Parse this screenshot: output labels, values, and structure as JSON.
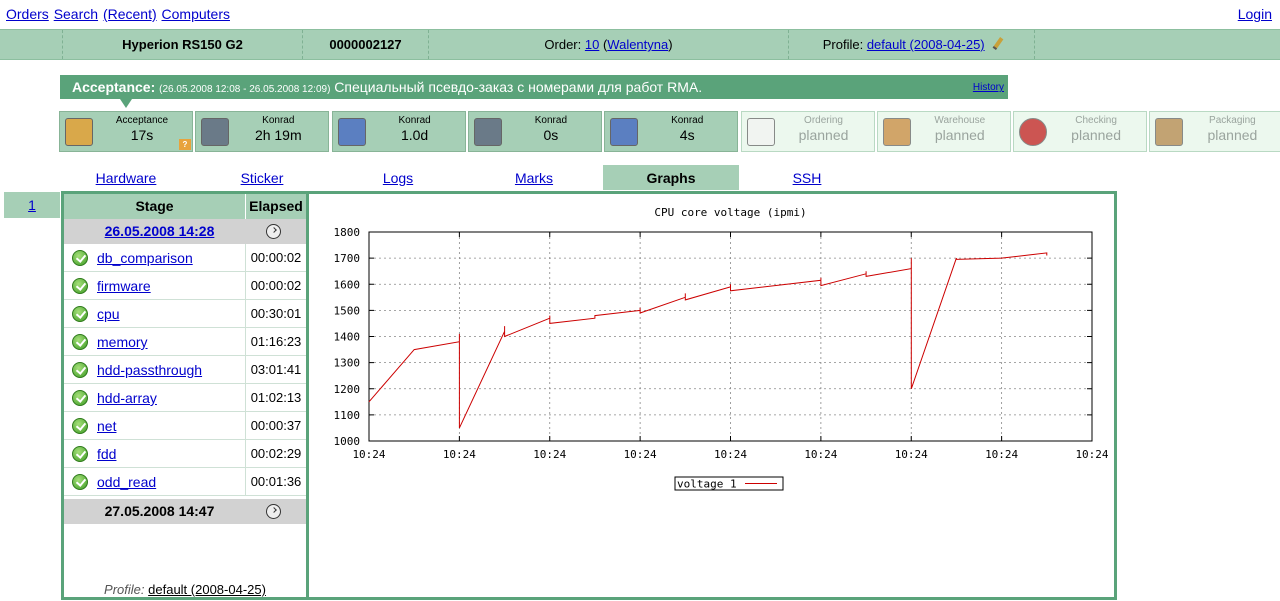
{
  "topnav": {
    "links": [
      "Orders",
      "Search",
      "(Recent)",
      "Computers"
    ],
    "login": "Login"
  },
  "header": {
    "model": "Hyperion RS150 G2",
    "serial": "0000002127",
    "order_label": "Order:",
    "order_number": "10",
    "order_customer": "Walentyna",
    "profile_label": "Profile:",
    "profile_value": "default (2008-04-25)"
  },
  "banner": {
    "stage": "Acceptance:",
    "dates": "(26.05.2008 12:08 - 26.05.2008 12:09)",
    "description": "Специальный псевдо-заказ с номерами для работ RMA.",
    "history": "History"
  },
  "stages": [
    {
      "label": "Acceptance",
      "value": "17s",
      "state": "done",
      "icon": "clipboard-box-icon"
    },
    {
      "label": "Konrad",
      "value": "2h 19m",
      "state": "done",
      "icon": "tools-icon"
    },
    {
      "label": "Konrad",
      "value": "1.0d",
      "state": "done",
      "icon": "checklist-icon"
    },
    {
      "label": "Konrad",
      "value": "0s",
      "state": "done",
      "icon": "tools-icon"
    },
    {
      "label": "Konrad",
      "value": "4s",
      "state": "done",
      "icon": "checklist-icon"
    },
    {
      "label": "Ordering",
      "value": "planned",
      "state": "planned",
      "icon": "order-envelope-icon"
    },
    {
      "label": "Warehouse",
      "value": "planned",
      "state": "planned",
      "icon": "box-icon"
    },
    {
      "label": "Checking",
      "value": "planned",
      "state": "planned",
      "icon": "seal-icon"
    },
    {
      "label": "Packaging",
      "value": "planned",
      "state": "planned",
      "icon": "package-icon"
    }
  ],
  "tabs": [
    "Hardware",
    "Sticker",
    "Logs",
    "Marks",
    "Graphs",
    "SSH"
  ],
  "active_tab": "Graphs",
  "run_number": "1",
  "stage_table": {
    "headers": [
      "Stage",
      "Elapsed"
    ],
    "start_date": "26.05.2008 14:28",
    "end_date": "27.05.2008 14:47",
    "rows": [
      {
        "name": "db_comparison",
        "elapsed": "00:00:02"
      },
      {
        "name": "firmware",
        "elapsed": "00:00:02"
      },
      {
        "name": "cpu",
        "elapsed": "00:30:01"
      },
      {
        "name": "memory",
        "elapsed": "01:16:23"
      },
      {
        "name": "hdd-passthrough",
        "elapsed": "03:01:41"
      },
      {
        "name": "hdd-array",
        "elapsed": "01:02:13"
      },
      {
        "name": "net",
        "elapsed": "00:00:37"
      },
      {
        "name": "fdd",
        "elapsed": "00:02:29"
      },
      {
        "name": "odd_read",
        "elapsed": "00:01:36"
      }
    ],
    "profile_label": "Profile:",
    "profile_value": "default (2008-04-25)"
  },
  "colors": {
    "accent": "#5aa37a",
    "header_bg": "#a6cfb6",
    "series": "#cc0000"
  },
  "chart_data": {
    "type": "line",
    "title": "CPU core voltage (ipmi)",
    "xlabel": "",
    "ylabel": "",
    "x_tick_labels": [
      "10:24",
      "10:24",
      "10:24",
      "10:24",
      "10:24",
      "10:24",
      "10:24",
      "10:24",
      "10:24"
    ],
    "ylim": [
      1000,
      1800
    ],
    "y_ticks": [
      1000,
      1100,
      1200,
      1300,
      1400,
      1500,
      1600,
      1700,
      1800
    ],
    "grid": true,
    "legend": "bottom-center",
    "series": [
      {
        "name": "voltage 1",
        "x": [
          0,
          0.5,
          1,
          1,
          1,
          1.5,
          1.5,
          1.5,
          2,
          2,
          2,
          2.5,
          2.5,
          3,
          3,
          3,
          3.5,
          3.5,
          3.5,
          4,
          4,
          4,
          5,
          5,
          5,
          5.5,
          5.5,
          5.5,
          6,
          6,
          6,
          6.5,
          6.5,
          7,
          7.5,
          7.5
        ],
        "y": [
          1150,
          1350,
          1380,
          1410,
          1050,
          1420,
          1440,
          1400,
          1470,
          1480,
          1450,
          1470,
          1480,
          1500,
          1510,
          1490,
          1550,
          1565,
          1540,
          1590,
          1600,
          1575,
          1615,
          1625,
          1595,
          1640,
          1650,
          1630,
          1660,
          1700,
          1200,
          1700,
          1695,
          1700,
          1720,
          1710
        ]
      }
    ]
  }
}
